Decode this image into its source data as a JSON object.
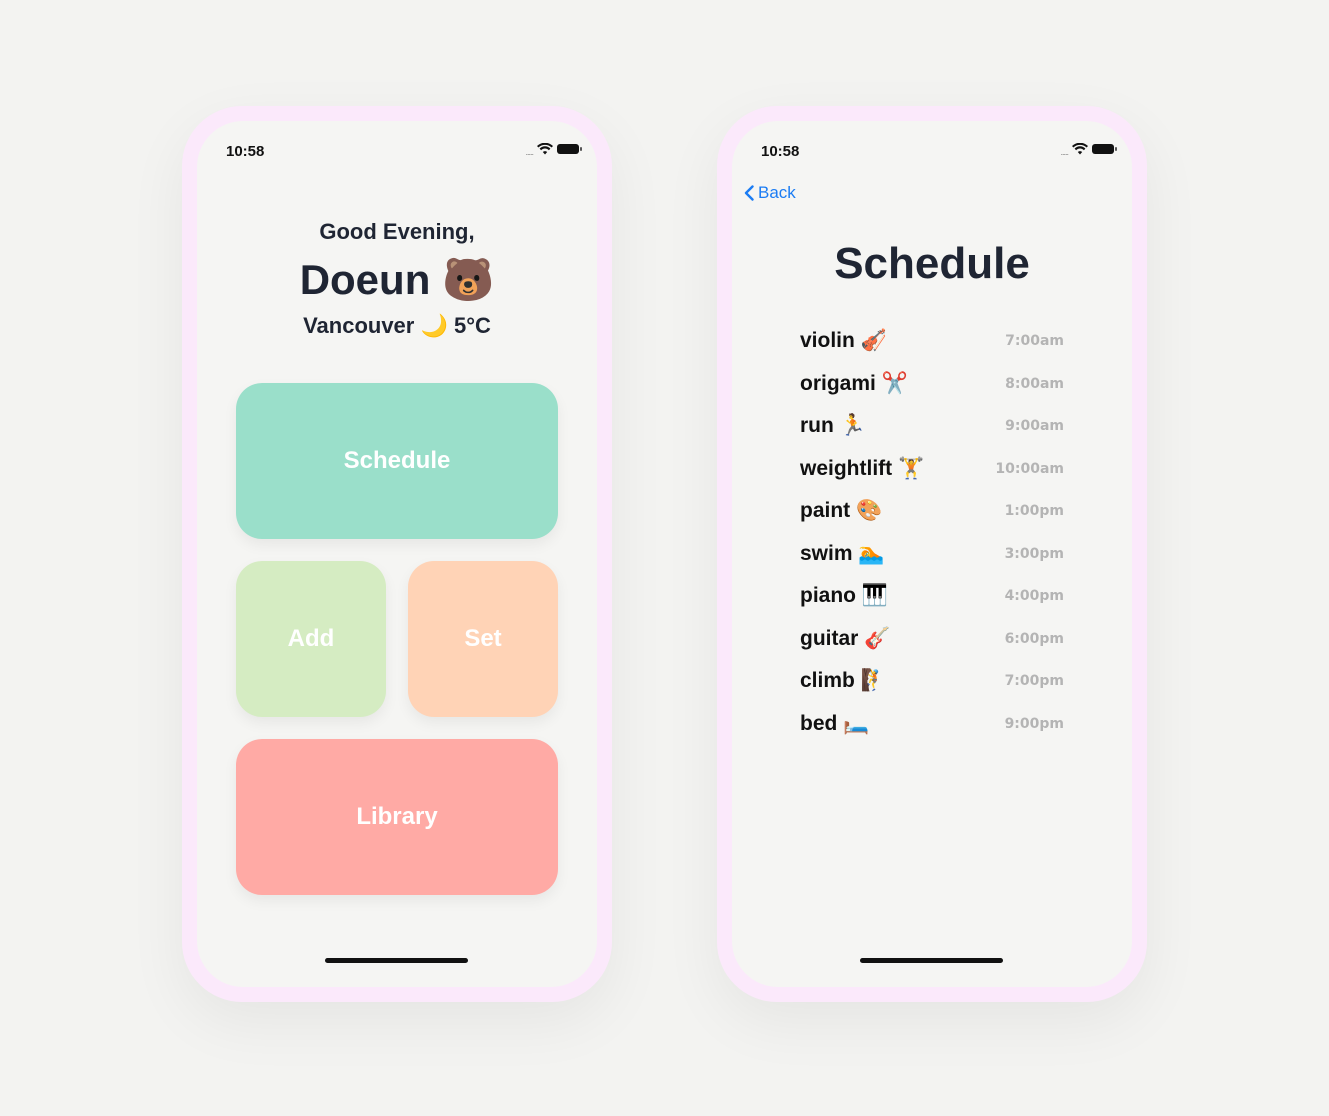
{
  "left_screen": {
    "status": {
      "time": "10:58",
      "signal": "....."
    },
    "greeting": "Good Evening,",
    "user_name": "Doeun 🐻",
    "weather": "Vancouver 🌙 5°C",
    "tiles": {
      "schedule": {
        "label": "Schedule",
        "color": "#9adfca"
      },
      "add": {
        "label": "Add",
        "color": "#d5ecc2"
      },
      "set": {
        "label": "Set",
        "color": "#ffd3b6"
      },
      "library": {
        "label": "Library",
        "color": "#ffaaa5"
      }
    }
  },
  "right_screen": {
    "status": {
      "time": "10:58",
      "signal": "....."
    },
    "back_label": "Back",
    "title": "Schedule",
    "items": [
      {
        "activity": "violin 🎻",
        "time": "7:00am"
      },
      {
        "activity": "origami ✂️",
        "time": "8:00am"
      },
      {
        "activity": "run 🏃",
        "time": "9:00am"
      },
      {
        "activity": "weightlift 🏋️",
        "time": "10:00am"
      },
      {
        "activity": "paint 🎨",
        "time": "1:00pm"
      },
      {
        "activity": "swim 🏊",
        "time": "3:00pm"
      },
      {
        "activity": "piano 🎹",
        "time": "4:00pm"
      },
      {
        "activity": "guitar 🎸",
        "time": "6:00pm"
      },
      {
        "activity": "climb 🧗",
        "time": "7:00pm"
      },
      {
        "activity": "bed 🛏️",
        "time": "9:00pm"
      }
    ]
  },
  "colors": {
    "accent_link": "#1b7cf3",
    "phone_frame": "#fbe9fb",
    "text_dark": "#1f2533",
    "time_grey": "#b4b4b4"
  },
  "icons": [
    "wifi-icon",
    "battery-icon",
    "chevron-left-icon"
  ]
}
